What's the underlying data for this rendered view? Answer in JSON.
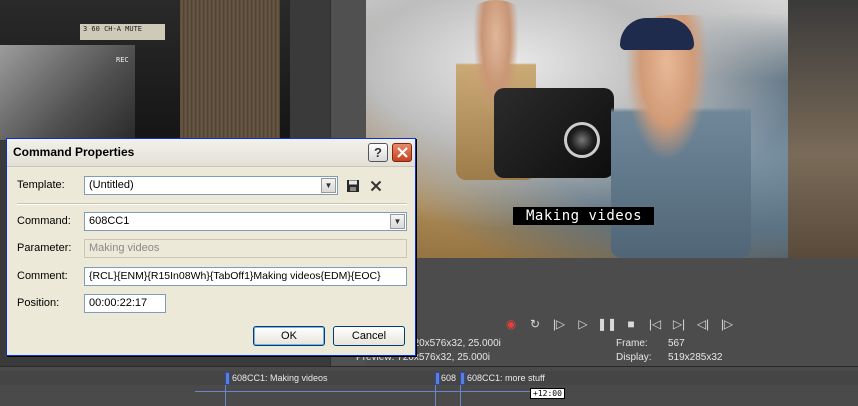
{
  "dialog": {
    "title": "Command Properties",
    "help_label": "?",
    "template": {
      "label": "Template:",
      "value": "(Untitled)"
    },
    "command": {
      "label": "Command:",
      "value": "608CC1"
    },
    "parameter": {
      "label": "Parameter:",
      "value": "Making videos"
    },
    "comment": {
      "label": "Comment:",
      "value": "{RCL}{ENM}{R15In08Wh}{TabOff1}Making videos{EDM}{EOC}"
    },
    "position": {
      "label": "Position:",
      "value": "00:00:22:17"
    },
    "ok_label": "OK",
    "cancel_label": "Cancel"
  },
  "preview": {
    "caption_text": "Making videos",
    "left_monitor_label": "3 60 CH-A MUTE",
    "left_monitor_rec": "REC"
  },
  "info": {
    "project_value": "720x576x32, 25.000i",
    "preview_label": "Preview:",
    "preview_value": "720x576x32, 25.000i",
    "frame_label": "Frame:",
    "frame_value": "567",
    "display_label": "Display:",
    "display_value": "519x285x32"
  },
  "timeline": {
    "clip1_label": "608CC1: Making videos",
    "clip2_label": "608",
    "clip3_label": "608CC1: more stuff",
    "time_tag": "+12:00"
  },
  "colors": {
    "accent": "#0831d9",
    "close": "#c7421d",
    "record": "#e04040",
    "marker": "#5b7fd8"
  },
  "transport_icons": [
    "record-icon",
    "loop-icon",
    "play-from-start-icon",
    "play-icon",
    "pause-icon",
    "stop-icon",
    "prev-frame-icon",
    "next-frame-icon",
    "step-back-icon",
    "step-forward-icon"
  ]
}
